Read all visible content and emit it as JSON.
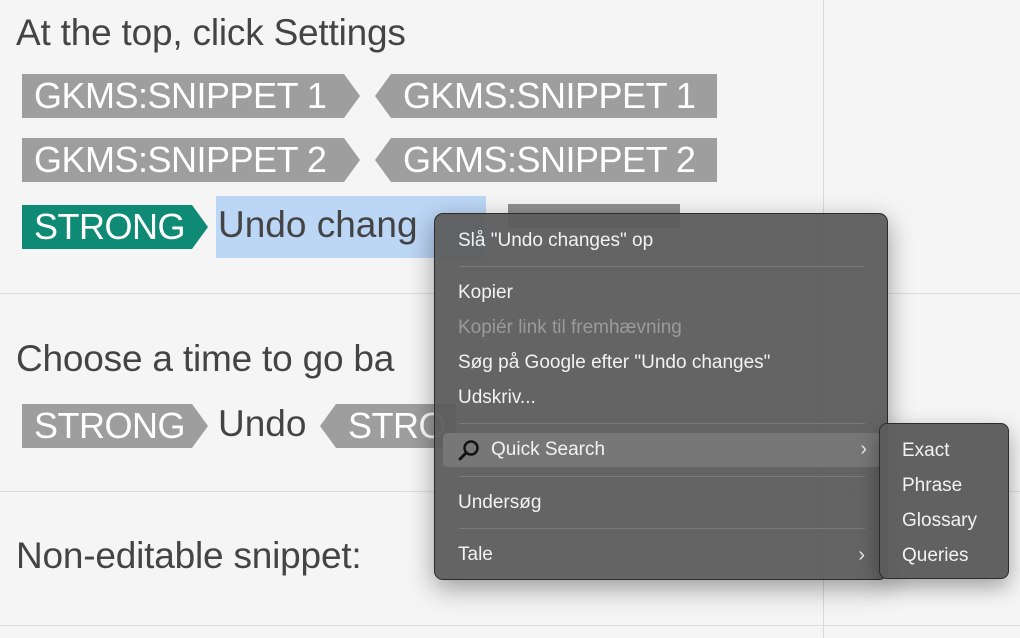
{
  "doc": {
    "step1_heading": "At the top, click Settings",
    "row1": {
      "open_tag": "GKMS:SNIPPET 1",
      "close_tag": "GKMS:SNIPPET 1"
    },
    "row2": {
      "open_tag": "GKMS:SNIPPET 2",
      "close_tag": "GKMS:SNIPPET 2"
    },
    "row3": {
      "open_tag": "STRONG",
      "selected_text": "Undo chang"
    },
    "step2_heading": "Choose a time to go ba",
    "row4": {
      "open_tag": "STRONG",
      "text": "Undo",
      "close_tag": "STRO"
    },
    "step3_heading": "Non-editable snippet:"
  },
  "context_menu": {
    "items": [
      {
        "label": "Slå \"Undo changes\" op",
        "enabled": true
      },
      {
        "label": "Kopier",
        "enabled": true
      },
      {
        "label": "Kopiér link til fremhævning",
        "enabled": false
      },
      {
        "label": "Søg på Google efter \"Undo changes\"",
        "enabled": true
      },
      {
        "label": "Udskriv...",
        "enabled": true
      },
      {
        "label": "Quick Search",
        "enabled": true,
        "icon": "magnifier-icon",
        "submenu": true,
        "highlighted": true
      },
      {
        "label": "Undersøg",
        "enabled": true
      },
      {
        "label": "Tale",
        "enabled": true,
        "submenu": true
      }
    ],
    "chevron": "›"
  },
  "quick_search_submenu": {
    "items": [
      "Exact",
      "Phrase",
      "Glossary",
      "Queries"
    ]
  },
  "colors": {
    "tag_gray": "#9e9e9e",
    "tag_green": "#0f8a75",
    "selection": "#bcd6f6",
    "menu_bg": "#5c5c5c"
  }
}
